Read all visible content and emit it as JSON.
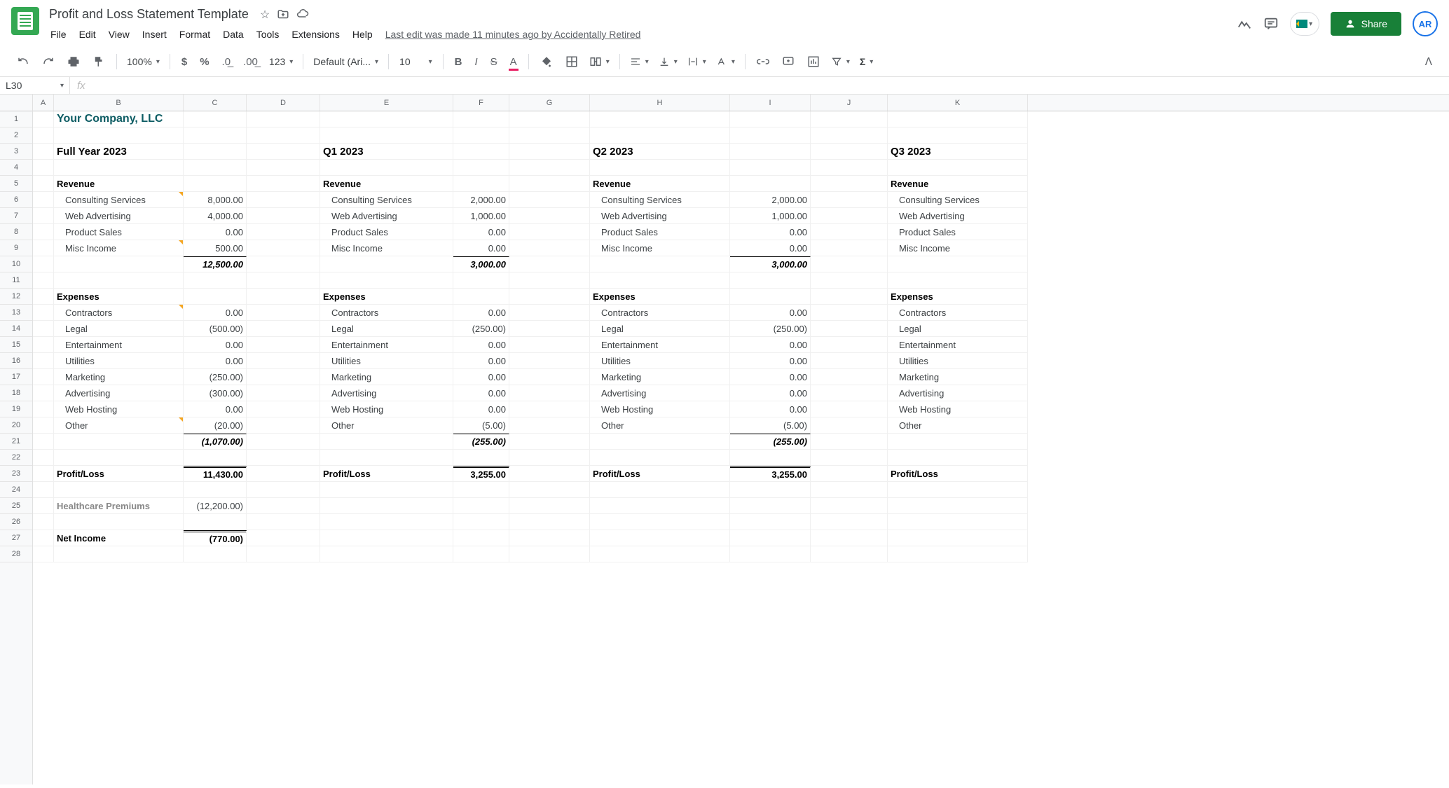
{
  "doc": {
    "title": "Profit and Loss Statement Template",
    "last_edit": "Last edit was made 11 minutes ago by Accidentally Retired"
  },
  "menus": [
    "File",
    "Edit",
    "View",
    "Insert",
    "Format",
    "Data",
    "Tools",
    "Extensions",
    "Help"
  ],
  "share": "Share",
  "avatar": "AR",
  "toolbar": {
    "zoom": "100%",
    "font": "Default (Ari...",
    "size": "10",
    "fmt123": "123"
  },
  "namebox": "L30",
  "columns": [
    "A",
    "B",
    "C",
    "D",
    "E",
    "F",
    "G",
    "H",
    "I",
    "J",
    "K"
  ],
  "company": "Your Company, LLC",
  "periods": {
    "full": "Full Year 2023",
    "q1": "Q1 2023",
    "q2": "Q2 2023",
    "q3": "Q3 2023"
  },
  "labels": {
    "revenue": "Revenue",
    "expenses": "Expenses",
    "profitloss": "Profit/Loss",
    "healthcare": "Healthcare Premiums",
    "netincome": "Net Income",
    "consulting": "Consulting Services",
    "webadv": "Web Advertising",
    "productsales": "Product Sales",
    "miscincome": "Misc Income",
    "contractors": "Contractors",
    "legal": "Legal",
    "entertainment": "Entertainment",
    "utilities": "Utilities",
    "marketing": "Marketing",
    "advertising": "Advertising",
    "webhosting": "Web Hosting",
    "other": "Other"
  },
  "full": {
    "consulting": "8,000.00",
    "webadv": "4,000.00",
    "productsales": "0.00",
    "miscincome": "500.00",
    "revenue_total": "12,500.00",
    "contractors": "0.00",
    "legal": "(500.00)",
    "entertainment": "0.00",
    "utilities": "0.00",
    "marketing": "(250.00)",
    "advertising": "(300.00)",
    "webhosting": "0.00",
    "other": "(20.00)",
    "expenses_total": "(1,070.00)",
    "profitloss": "11,430.00",
    "healthcare": "(12,200.00)",
    "netincome": "(770.00)"
  },
  "q1": {
    "consulting": "2,000.00",
    "webadv": "1,000.00",
    "productsales": "0.00",
    "miscincome": "0.00",
    "revenue_total": "3,000.00",
    "contractors": "0.00",
    "legal": "(250.00)",
    "entertainment": "0.00",
    "utilities": "0.00",
    "marketing": "0.00",
    "advertising": "0.00",
    "webhosting": "0.00",
    "other": "(5.00)",
    "expenses_total": "(255.00)",
    "profitloss": "3,255.00"
  },
  "q2": {
    "consulting": "2,000.00",
    "webadv": "1,000.00",
    "productsales": "0.00",
    "miscincome": "0.00",
    "revenue_total": "3,000.00",
    "contractors": "0.00",
    "legal": "(250.00)",
    "entertainment": "0.00",
    "utilities": "0.00",
    "marketing": "0.00",
    "advertising": "0.00",
    "webhosting": "0.00",
    "other": "(5.00)",
    "expenses_total": "(255.00)",
    "profitloss": "3,255.00"
  }
}
